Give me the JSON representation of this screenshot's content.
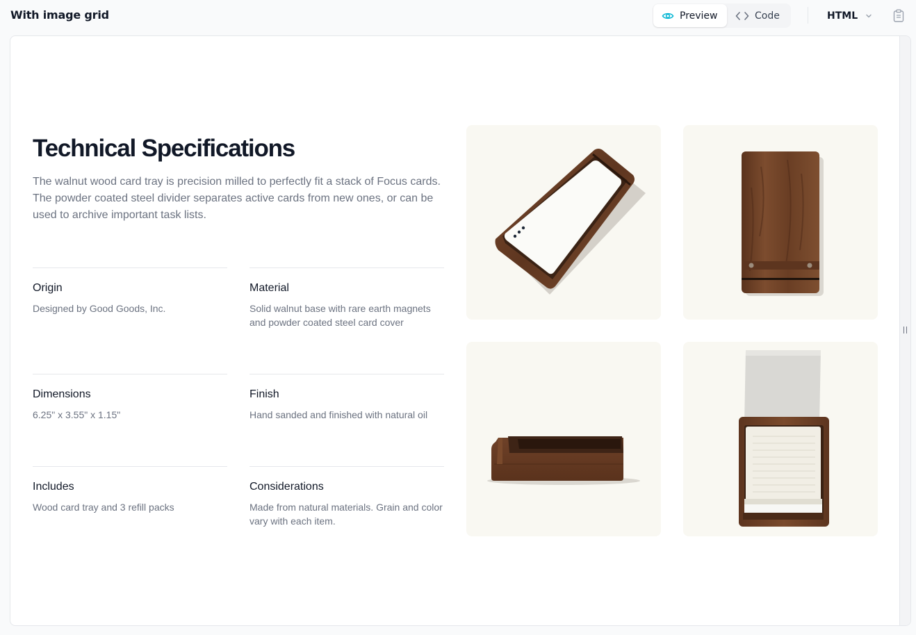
{
  "header": {
    "title": "With image grid",
    "tabs": [
      {
        "label": "Preview",
        "active": true
      },
      {
        "label": "Code",
        "active": false
      }
    ],
    "language": "HTML"
  },
  "preview": {
    "heading": "Technical Specifications",
    "description": "The walnut wood card tray is precision milled to perfectly fit a stack of Focus cards. The powder coated steel divider separates active cards from new ones, or can be used to archive important task lists.",
    "specs": [
      {
        "term": "Origin",
        "detail": "Designed by Good Goods, Inc."
      },
      {
        "term": "Material",
        "detail": "Solid walnut base with rare earth magnets and powder coated steel card cover"
      },
      {
        "term": "Dimensions",
        "detail": "6.25\" x 3.55\" x 1.15\""
      },
      {
        "term": "Finish",
        "detail": "Hand sanded and finished with natural oil"
      },
      {
        "term": "Includes",
        "detail": "Wood card tray and 3 refill packs"
      },
      {
        "term": "Considerations",
        "detail": "Made from natural materials. Grain and color vary with each item."
      }
    ]
  },
  "colors": {
    "accent": "#06b6d4",
    "text": "#111827",
    "muted": "#6b7280",
    "tile_background": "#f9f8f2",
    "walnut": "#6b4128"
  },
  "icons": [
    "eye-icon",
    "code-icon",
    "chevron-down-icon",
    "clipboard-icon",
    "resize-grip-icon"
  ]
}
